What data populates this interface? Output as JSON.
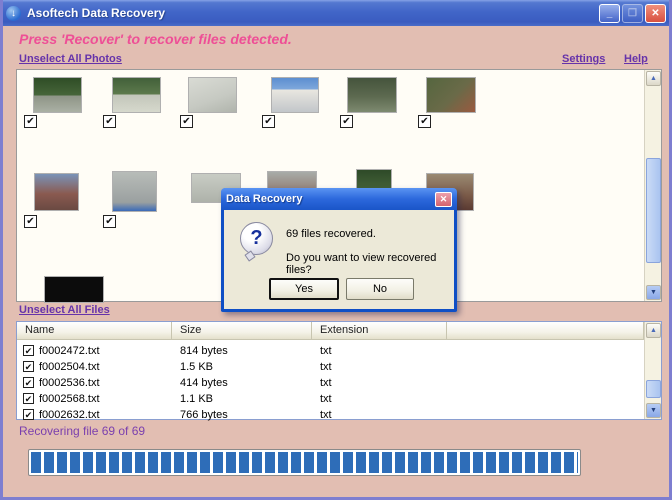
{
  "window": {
    "title": "Asoftech Data Recovery"
  },
  "ui": {
    "check": "✔",
    "arrow_up": "▲",
    "arrow_down": "▼",
    "minimize_glyph": "_",
    "maximize_glyph": "❐",
    "close_glyph": "✕",
    "app_icon_glyph": "↓",
    "question_glyph": "?"
  },
  "header": {
    "message": "Press 'Recover' to recover files detected.",
    "unselect_photos_label": "Unselect All Photos",
    "settings_label": "Settings",
    "help_label": "Help"
  },
  "photo_grid": {
    "thumbnail_count": 13,
    "all_checked": true
  },
  "dialog": {
    "title": "Data Recovery",
    "message_line1": "69 files recovered.",
    "message_line2": "Do you want to view recovered files?",
    "yes_label": "Yes",
    "no_label": "No"
  },
  "files": {
    "unselect_label": "Unselect All Files",
    "columns": [
      "Name",
      "Size",
      "Extension"
    ],
    "rows": [
      {
        "checked": true,
        "name": "f0002472.txt",
        "size": "814 bytes",
        "ext": "txt"
      },
      {
        "checked": true,
        "name": "f0002504.txt",
        "size": "1.5 KB",
        "ext": "txt"
      },
      {
        "checked": true,
        "name": "f0002536.txt",
        "size": "414 bytes",
        "ext": "txt"
      },
      {
        "checked": true,
        "name": "f0002568.txt",
        "size": "1.1 KB",
        "ext": "txt"
      },
      {
        "checked": true,
        "name": "f0002632.txt",
        "size": "766 bytes",
        "ext": "txt"
      }
    ]
  },
  "status": {
    "text": "Recovering file 69 of 69",
    "progress_percent": 100
  },
  "colors": {
    "accent_blue": "#2e6db8",
    "message_pink": "#ee4f96",
    "link_purple": "#6633aa",
    "background_pink": "#e2beb2",
    "titlebar_blue": "#4166c8"
  }
}
